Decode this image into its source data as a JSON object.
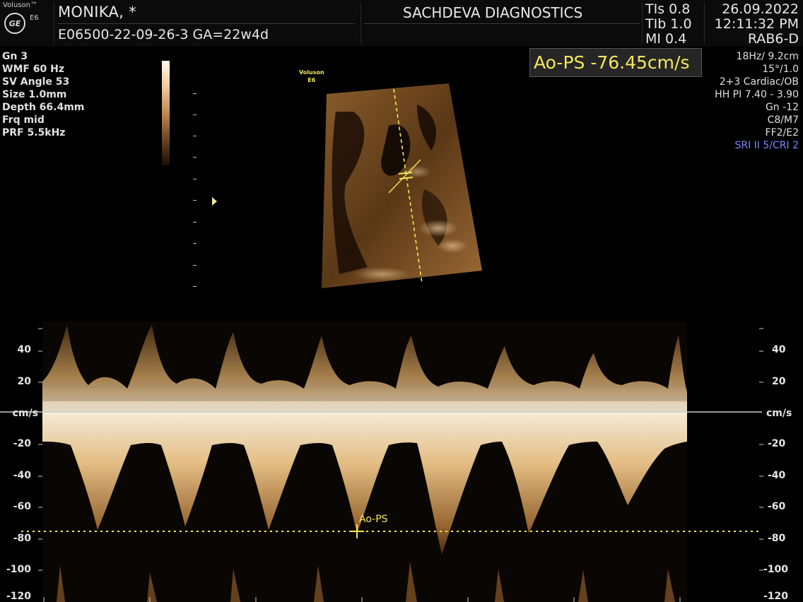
{
  "header": {
    "brand": "Voluson™",
    "logo": "GE",
    "model": "E6",
    "patient_name": "MONIKA,   *",
    "patient_id_ga": "E06500-22-09-26-3  GA=22w4d",
    "clinic": "SACHDEVA DIAGNOSTICS",
    "tis": "TIs  0.8",
    "tib": "TIb  1.0",
    "mi": "MI  0.4",
    "date": "26.09.2022",
    "time": "12:11:32 PM",
    "probe": "RAB6-D"
  },
  "left_params": [
    "Gn  3",
    "WMF 60 Hz",
    "SV Angle 53",
    "Size  1.0mm",
    "Depth 66.4mm",
    "Frq mid",
    "PRF  5.5kHz"
  ],
  "right_params": [
    "18Hz/ 9.2cm",
    "15°/1.0",
    "2+3 Cardiac/OB",
    "HH PI 7.40 - 3.90",
    "Gn -12",
    "C8/M7",
    "FF2/E2"
  ],
  "right_params_highlight": "SRI II 5/CRI 2",
  "measurement": {
    "label": "Ao-PS -76.45cm/s",
    "cursor_label": "Ao-PS",
    "value_cm_s": -76.45
  },
  "image_label": {
    "line1": "Voluson",
    "line2": "E6"
  },
  "doppler_axis": {
    "unit": "cm/s",
    "ticks": [
      "40",
      "20",
      "-20",
      "-40",
      "-60",
      "-80",
      "-100",
      "-120"
    ]
  },
  "colors": {
    "measure_yellow": "#f3e85a",
    "doppler_tone": "#f2d3a0",
    "highlight_blue": "#7f86ff"
  }
}
